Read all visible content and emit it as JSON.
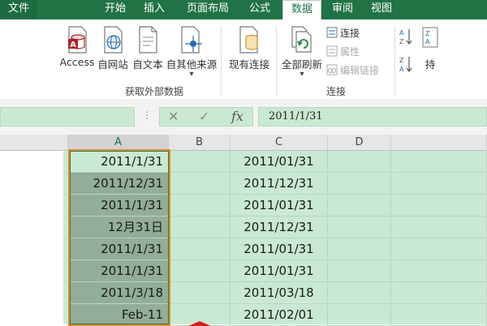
{
  "ribbon_tabs": [
    {
      "label": "文件"
    },
    {
      "label": "开始"
    },
    {
      "label": "插入"
    },
    {
      "label": "页面布局"
    },
    {
      "label": "公式"
    },
    {
      "label": "数据"
    },
    {
      "label": "审阅"
    },
    {
      "label": "视图"
    }
  ],
  "external_data_group": {
    "label": "获取外部数据",
    "buttons": [
      {
        "label": "Access",
        "icon": "access-database-icon"
      },
      {
        "label": "自网站",
        "icon": "web-globe-icon"
      },
      {
        "label": "自文本",
        "icon": "text-file-icon"
      },
      {
        "label": "自其他来源",
        "icon": "other-sources-icon"
      },
      {
        "label": "现有连接",
        "icon": "existing-connections-icon"
      }
    ]
  },
  "connections_group": {
    "label": "连接",
    "refresh_all": {
      "label": "全部刷新",
      "icon": "refresh-all-icon"
    },
    "connections": {
      "label": "连接",
      "icon": "connections-icon"
    },
    "properties": {
      "label": "属性",
      "icon": "properties-icon"
    },
    "edit_links": {
      "label": "编辑链接",
      "icon": "edit-links-icon"
    }
  },
  "sort_group": {
    "partial_label": "持",
    "sort_az_icon": "sort-ascending-icon",
    "sort_za_icon": "sort-descending-icon"
  },
  "formula_bar": {
    "fx_label": "fx",
    "dots": "⋮",
    "value": "2011/1/31"
  },
  "columns": [
    "A",
    "B",
    "C",
    "D"
  ],
  "selected_column": "A",
  "rows": [
    {
      "a": "2011/1/31",
      "c": "2011/01/31"
    },
    {
      "a": "2011/12/31",
      "c": "2011/12/31"
    },
    {
      "a": "2011/1/31",
      "c": "2011/01/31"
    },
    {
      "a": "12月31日",
      "c": "2011/12/31"
    },
    {
      "a": "2011/1/31",
      "c": "2011/01/31"
    },
    {
      "a": "2011/1/31",
      "c": "2011/01/31"
    },
    {
      "a": "2011/3/18",
      "c": "2011/03/18"
    },
    {
      "a": "Feb-11",
      "c": "2011/02/01"
    }
  ],
  "colors": {
    "ribbon_green": "#217346",
    "sheet_fill": "#c9e9d2",
    "selected_fill": "#92ad98",
    "selection_outline": "#e08c34",
    "annotation_arrow": "#d0211b"
  }
}
